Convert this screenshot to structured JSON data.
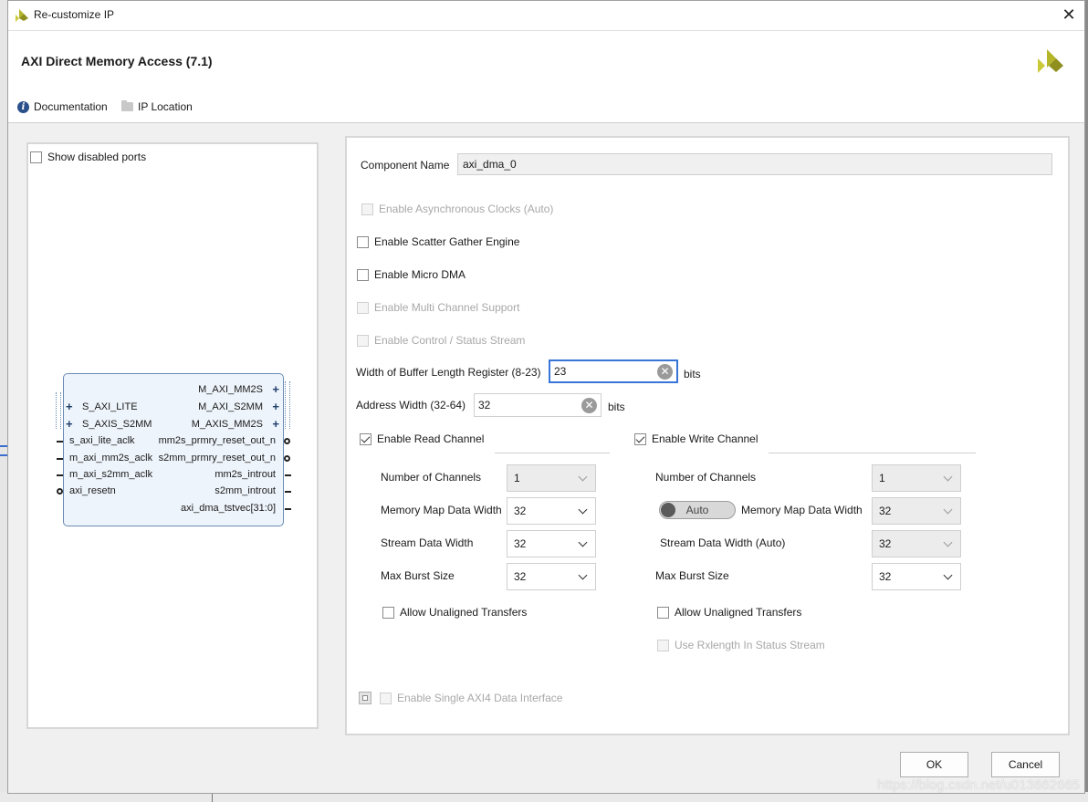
{
  "window": {
    "title": "Re-customize IP",
    "close_glyph": "✕"
  },
  "header": {
    "ip_name": "AXI Direct Memory Access (7.1)",
    "documentation_label": "Documentation",
    "ip_location_label": "IP Location",
    "info_glyph": "i"
  },
  "left": {
    "show_disabled_ports_label": "Show disabled ports",
    "show_disabled_ports_checked": false,
    "block": {
      "left_ports": [
        {
          "name": "S_AXI_LITE",
          "kind": "bus"
        },
        {
          "name": "S_AXIS_S2MM",
          "kind": "bus"
        },
        {
          "name": "s_axi_lite_aclk",
          "kind": "pin"
        },
        {
          "name": "m_axi_mm2s_aclk",
          "kind": "pin"
        },
        {
          "name": "m_axi_s2mm_aclk",
          "kind": "pin"
        },
        {
          "name": "axi_resetn",
          "kind": "bubble"
        }
      ],
      "right_ports": [
        {
          "name": "M_AXI_MM2S",
          "kind": "bus"
        },
        {
          "name": "M_AXI_S2MM",
          "kind": "bus"
        },
        {
          "name": "M_AXIS_MM2S",
          "kind": "bus"
        },
        {
          "name": "mm2s_prmry_reset_out_n",
          "kind": "bubble"
        },
        {
          "name": "s2mm_prmry_reset_out_n",
          "kind": "bubble"
        },
        {
          "name": "mm2s_introut",
          "kind": "pin"
        },
        {
          "name": "s2mm_introut",
          "kind": "pin"
        },
        {
          "name": "axi_dma_tstvec[31:0]",
          "kind": "pin"
        }
      ]
    }
  },
  "config": {
    "component_name_label": "Component Name",
    "component_name_value": "axi_dma_0",
    "enable_async_clocks_label": "Enable Asynchronous Clocks (Auto)",
    "enable_scatter_gather_label": "Enable Scatter Gather Engine",
    "enable_micro_dma_label": "Enable Micro DMA",
    "enable_multi_channel_label": "Enable Multi Channel Support",
    "enable_control_status_label": "Enable Control / Status Stream",
    "buffer_length_label": "Width of Buffer Length Register (8-23)",
    "buffer_length_value": "23",
    "buffer_length_unit": "bits",
    "address_width_label": "Address Width (32-64)",
    "address_width_value": "32",
    "address_width_unit": "bits",
    "clear_glyph": "✕",
    "enable_single_axi4_label": "Enable Single AXI4 Data Interface"
  },
  "read_channel": {
    "enable_label": "Enable Read Channel",
    "enabled": true,
    "num_channels_label": "Number of Channels",
    "num_channels_value": "1",
    "mm_data_width_label": "Memory Map Data Width",
    "mm_data_width_value": "32",
    "stream_data_width_label": "Stream Data Width",
    "stream_data_width_value": "32",
    "max_burst_label": "Max Burst Size",
    "max_burst_value": "32",
    "allow_unaligned_label": "Allow Unaligned Transfers"
  },
  "write_channel": {
    "enable_label": "Enable Write Channel",
    "enabled": true,
    "num_channels_label": "Number of Channels",
    "num_channels_value": "1",
    "auto_toggle_label": "Auto",
    "mm_data_width_label": "Memory Map Data Width",
    "mm_data_width_value": "32",
    "stream_data_width_label": "Stream Data Width (Auto)",
    "stream_data_width_value": "32",
    "max_burst_label": "Max Burst Size",
    "max_burst_value": "32",
    "allow_unaligned_label": "Allow Unaligned Transfers",
    "use_rxlength_label": "Use Rxlength In Status Stream"
  },
  "footer": {
    "ok_label": "OK",
    "cancel_label": "Cancel"
  },
  "watermark": "https://blog.csdn.net/u013662665",
  "colors": {
    "focus_border": "#3875d7",
    "block_fill": "#eef4fb",
    "block_border": "#6b8bb4",
    "logo_color": "#b5b52a"
  }
}
